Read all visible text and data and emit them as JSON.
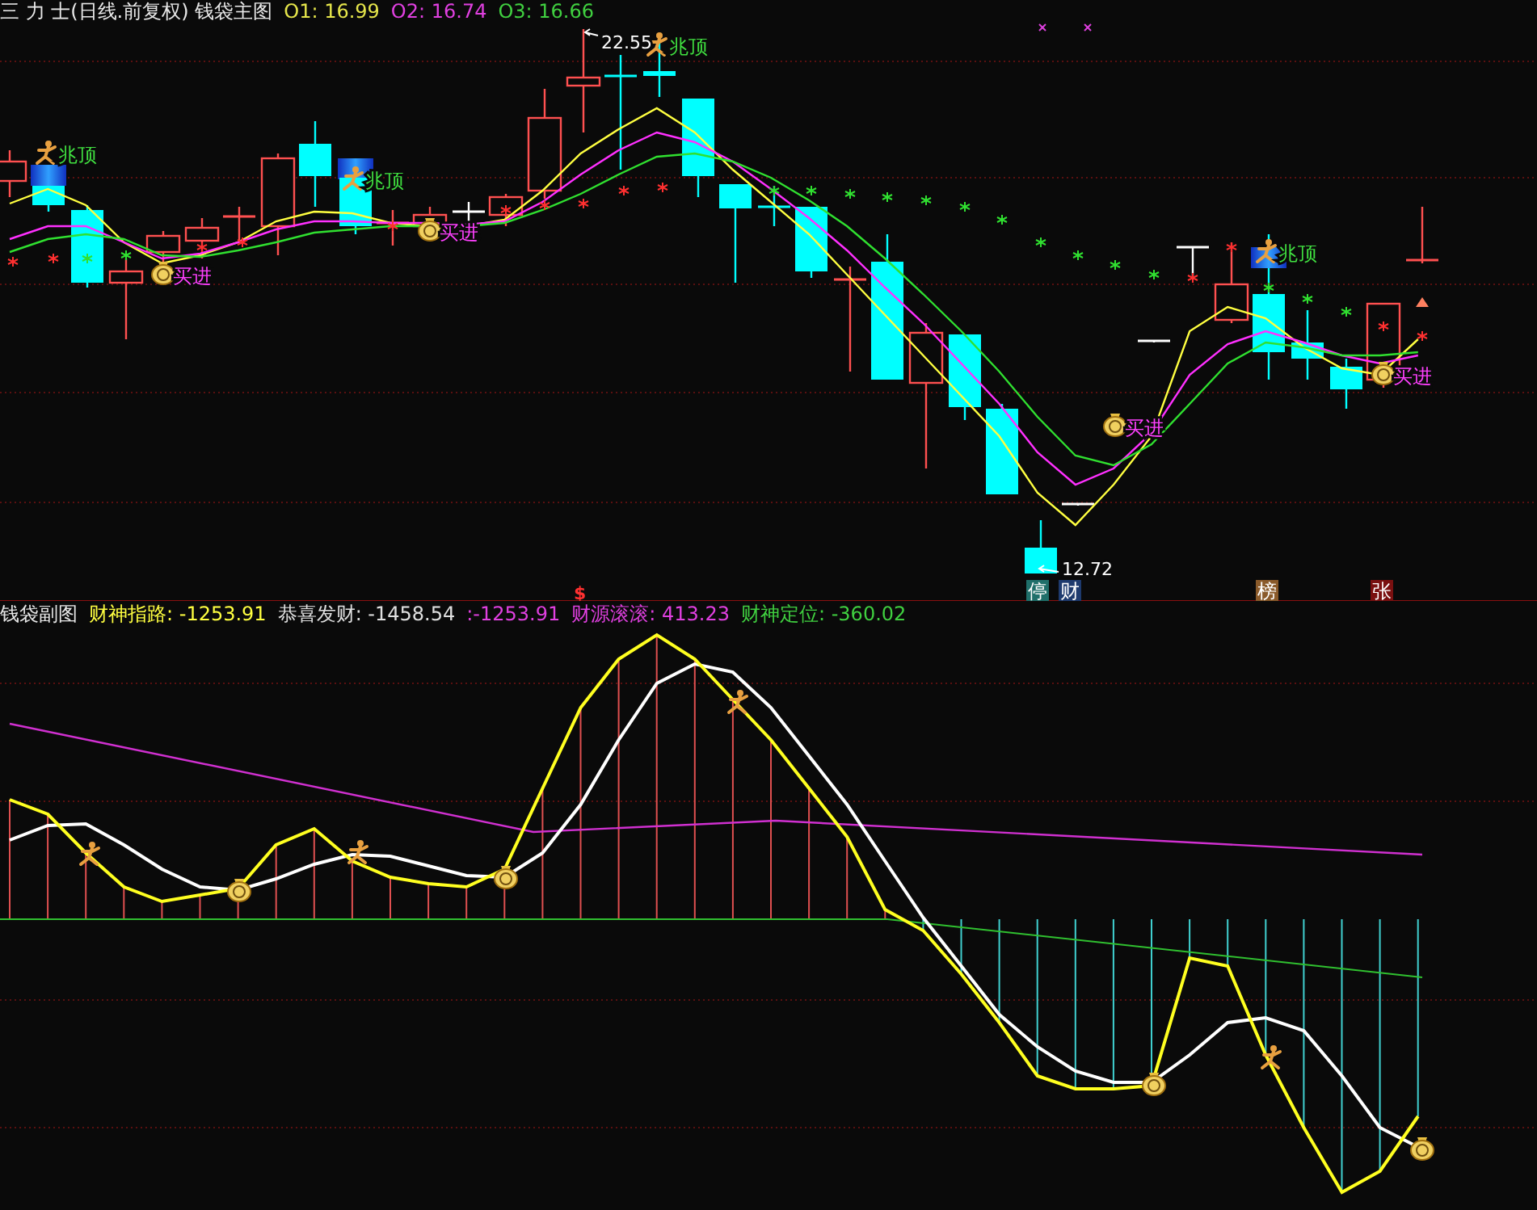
{
  "main_chart": {
    "title": "三 力 士(日线.前复权) 钱袋主图",
    "indicators": [
      {
        "text": "O1: 16.99",
        "color": "#e6e64b"
      },
      {
        "text": "O2: 16.74",
        "color": "#e040e0"
      },
      {
        "text": "O3: 16.66",
        "color": "#40d040"
      }
    ],
    "price_labels": [
      "22.55",
      "12.72"
    ],
    "signals": [
      {
        "kind": "top",
        "text": "兆顶"
      },
      {
        "kind": "buy",
        "text": "买进"
      },
      {
        "kind": "top",
        "text": "兆顶"
      },
      {
        "kind": "buy",
        "text": "买进"
      },
      {
        "kind": "top",
        "text": "兆顶"
      },
      {
        "kind": "buy",
        "text": "买进"
      },
      {
        "kind": "top",
        "text": "兆顶"
      },
      {
        "kind": "buy",
        "text": "买进"
      }
    ],
    "marker": "$",
    "badges": [
      {
        "text": "停",
        "color": "#1f6f6a"
      },
      {
        "text": "财",
        "color": "#1e3a6e"
      },
      {
        "text": "榜",
        "color": "#8a5a2a"
      },
      {
        "text": "张",
        "color": "#7a1010"
      }
    ]
  },
  "sub_chart": {
    "title": "钱袋副图",
    "indicators": [
      {
        "text": "财神指路: -1253.91",
        "color": "#ffff40"
      },
      {
        "text": "恭喜发财: -1458.54",
        "color": "#e0e0e0"
      },
      {
        "text": ":-1253.91",
        "color": "#e040e0"
      },
      {
        "text": "财源滚滚: 413.23",
        "color": "#e040e0"
      },
      {
        "text": "财神定位: -360.02",
        "color": "#40d040"
      }
    ]
  }
}
